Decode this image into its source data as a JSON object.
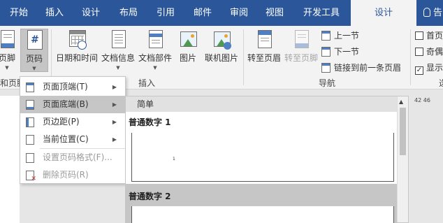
{
  "tabs": [
    {
      "label": "开始"
    },
    {
      "label": "插入"
    },
    {
      "label": "设计"
    },
    {
      "label": "布局"
    },
    {
      "label": "引用"
    },
    {
      "label": "邮件"
    },
    {
      "label": "审阅"
    },
    {
      "label": "视图"
    },
    {
      "label": "开发工具"
    },
    {
      "label": "设计",
      "active": true
    }
  ],
  "tell_me_partial": "告",
  "ribbon": {
    "footer_label": "页脚",
    "page_number_label": "页码",
    "date_time_label": "日期和时间",
    "doc_info_label": "文档信息",
    "doc_parts_label": "文档部件",
    "picture_label": "图片",
    "online_picture_label": "联机图片",
    "goto_header_label": "转至页眉",
    "goto_footer_label": "转至页脚",
    "prev_label": "上一节",
    "next_label": "下一节",
    "link_prev_label": "链接到前一条页眉",
    "group_header_footer": "和页脚",
    "group_insert": "插入",
    "group_nav": "导航",
    "group_options_partial": "选",
    "opt_first_page": "首页",
    "opt_odd_even": "奇偶",
    "opt_show": "显示"
  },
  "menu": {
    "items": [
      {
        "label": "页面顶端(T)",
        "has_submenu": true
      },
      {
        "label": "页面底端(B)",
        "has_submenu": true,
        "highlighted": true
      },
      {
        "label": "页边距(P)",
        "has_submenu": true
      },
      {
        "label": "当前位置(C)",
        "has_submenu": true
      },
      {
        "label": "设置页码格式(F)..."
      },
      {
        "label": "删除页码(R)"
      }
    ]
  },
  "gallery": {
    "section_header": "简单",
    "items": [
      {
        "title": "普通数字 1",
        "preview_number": "1"
      },
      {
        "title": "普通数字 2"
      }
    ]
  },
  "ruler_text": "42 46"
}
